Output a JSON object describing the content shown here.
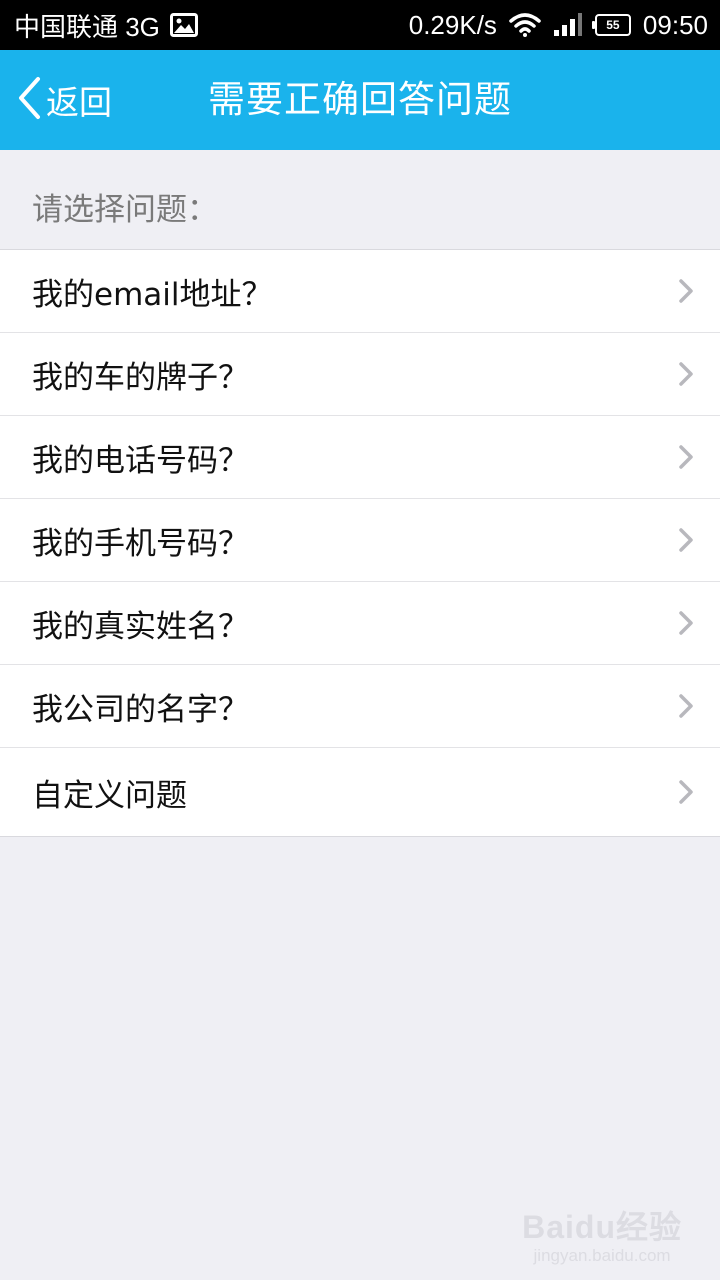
{
  "status_bar": {
    "carrier": "中国联通 3G",
    "speed": "0.29K/s",
    "battery_level": "55",
    "time": "09:50"
  },
  "nav": {
    "back_label": "返回",
    "title": "需要正确回答问题"
  },
  "section_header": "请选择问题：",
  "questions": [
    {
      "label": "我的email地址？"
    },
    {
      "label": "我的车的牌子？"
    },
    {
      "label": "我的电话号码？"
    },
    {
      "label": "我的手机号码？"
    },
    {
      "label": "我的真实姓名？"
    },
    {
      "label": "我公司的名字？"
    },
    {
      "label": "自定义问题"
    }
  ],
  "watermark": {
    "logo": "Baidu经验",
    "url": "jingyan.baidu.com"
  },
  "colors": {
    "nav_bar": "#1ab3ec",
    "background": "#efeff4",
    "chevron": "#b8b8bd"
  }
}
